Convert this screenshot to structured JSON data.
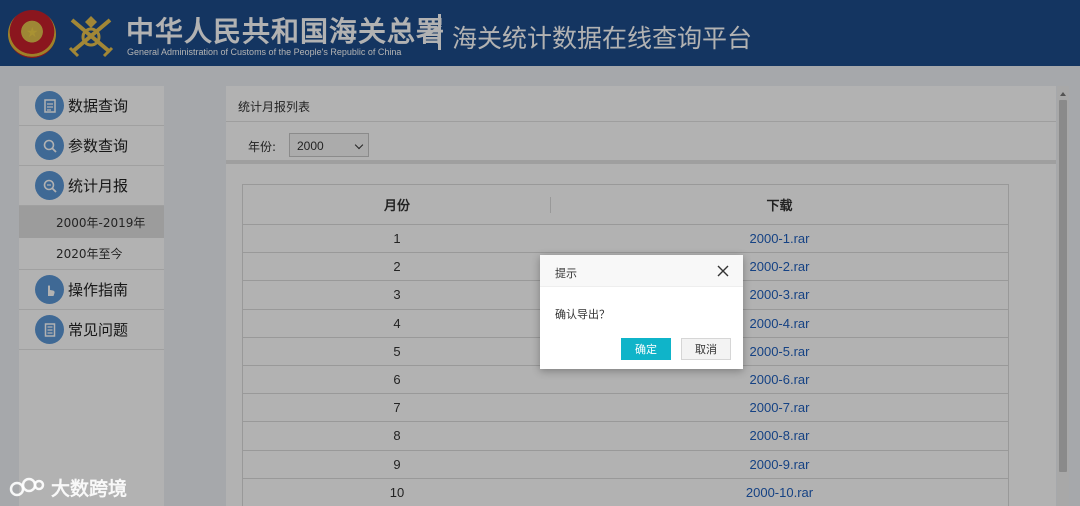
{
  "header": {
    "title_cn": "中华人民共和国海关总署",
    "title_en": "General Administration of Customs of the People's Republic of China",
    "subtitle": "海关统计数据在线查询平台",
    "emblem_icon": "national-emblem-icon",
    "logo_icon": "customs-logo-icon",
    "bg_color": "#1d4d8c"
  },
  "sidebar": {
    "items": [
      {
        "label": "数据查询",
        "icon": "data-query-icon"
      },
      {
        "label": "参数查询",
        "icon": "param-query-icon"
      },
      {
        "label": "统计月报",
        "icon": "monthly-report-icon"
      },
      {
        "label": "操作指南",
        "icon": "guide-hand-icon"
      },
      {
        "label": "常见问题",
        "icon": "faq-doc-icon"
      }
    ],
    "sub_items": [
      {
        "label": "2000年-2019年",
        "active": true
      },
      {
        "label": "2020年至今",
        "active": false
      }
    ]
  },
  "panel": {
    "title": "统计月报列表",
    "year_label": "年份:",
    "year_selected": "2000"
  },
  "table": {
    "headers": [
      "月份",
      "下载"
    ],
    "rows": [
      {
        "month": "1",
        "file": "2000-1.rar"
      },
      {
        "month": "2",
        "file": "2000-2.rar"
      },
      {
        "month": "3",
        "file": "2000-3.rar"
      },
      {
        "month": "4",
        "file": "2000-4.rar"
      },
      {
        "month": "5",
        "file": "2000-5.rar"
      },
      {
        "month": "6",
        "file": "2000-6.rar"
      },
      {
        "month": "7",
        "file": "2000-7.rar"
      },
      {
        "month": "8",
        "file": "2000-8.rar"
      },
      {
        "month": "9",
        "file": "2000-9.rar"
      },
      {
        "month": "10",
        "file": "2000-10.rar"
      }
    ]
  },
  "dialog": {
    "title": "提示",
    "message": "确认导出？",
    "ok_label": "确定",
    "cancel_label": "取消",
    "ok_color": "#0fb4c9"
  },
  "watermark": {
    "text": "大数跨境"
  }
}
